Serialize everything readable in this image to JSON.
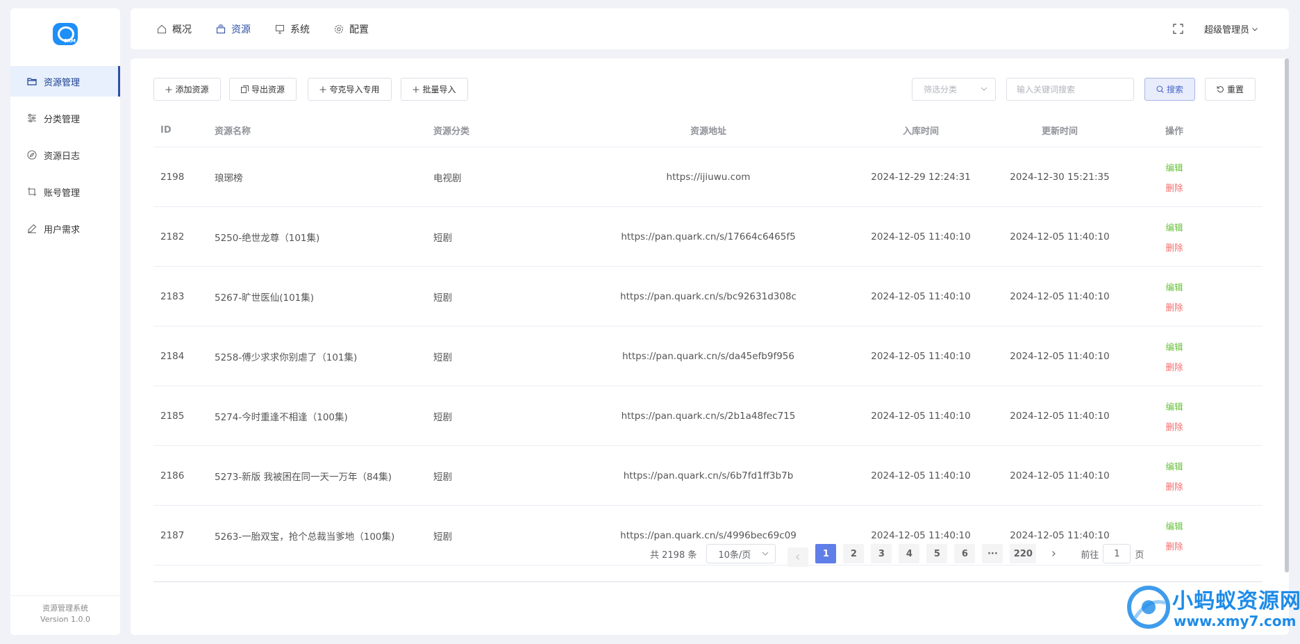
{
  "sidebar": {
    "logo_text": "CRM",
    "items": [
      {
        "label": "资源管理",
        "icon": "folder-icon",
        "active": true
      },
      {
        "label": "分类管理",
        "icon": "sliders-icon",
        "active": false
      },
      {
        "label": "资源日志",
        "icon": "compass-icon",
        "active": false
      },
      {
        "label": "账号管理",
        "icon": "crop-icon",
        "active": false
      },
      {
        "label": "用户需求",
        "icon": "pen-icon",
        "active": false
      }
    ],
    "footer_title": "资源管理系统",
    "footer_version": "Version 1.0.0"
  },
  "topbar": {
    "tabs": [
      {
        "label": "概况",
        "icon": "home-icon",
        "active": false
      },
      {
        "label": "资源",
        "icon": "stack-icon",
        "active": true
      },
      {
        "label": "系统",
        "icon": "monitor-icon",
        "active": false
      },
      {
        "label": "配置",
        "icon": "gear-icon",
        "active": false
      }
    ],
    "user_label": "超级管理员"
  },
  "toolbar": {
    "add_label": "添加资源",
    "export_label": "导出资源",
    "quark_import_label": "夸克导入专用",
    "batch_import_label": "批量导入",
    "category_placeholder": "筛选分类",
    "keyword_placeholder": "输入关键词搜索",
    "search_label": "搜索",
    "reset_label": "重置"
  },
  "table": {
    "headers": {
      "id": "ID",
      "name": "资源名称",
      "category": "资源分类",
      "url": "资源地址",
      "created": "入库时间",
      "updated": "更新时间",
      "actions": "操作"
    },
    "edit_label": "编辑",
    "delete_label": "删除",
    "rows": [
      {
        "id": "2198",
        "name": "琅琊榜",
        "category": "电视剧",
        "url": "https://ijiuwu.com",
        "created": "2024-12-29 12:24:31",
        "updated": "2024-12-30 15:21:35"
      },
      {
        "id": "2182",
        "name": "5250-绝世龙尊（101集)",
        "category": "短剧",
        "url": "https://pan.quark.cn/s/17664c6465f5",
        "created": "2024-12-05 11:40:10",
        "updated": "2024-12-05 11:40:10"
      },
      {
        "id": "2183",
        "name": "5267-旷世医仙(101集)",
        "category": "短剧",
        "url": "https://pan.quark.cn/s/bc92631d308c",
        "created": "2024-12-05 11:40:10",
        "updated": "2024-12-05 11:40:10"
      },
      {
        "id": "2184",
        "name": "5258-傅少求求你别虐了（101集)",
        "category": "短剧",
        "url": "https://pan.quark.cn/s/da45efb9f956",
        "created": "2024-12-05 11:40:10",
        "updated": "2024-12-05 11:40:10"
      },
      {
        "id": "2185",
        "name": "5274-今时重逢不相逢（100集)",
        "category": "短剧",
        "url": "https://pan.quark.cn/s/2b1a48fec715",
        "created": "2024-12-05 11:40:10",
        "updated": "2024-12-05 11:40:10"
      },
      {
        "id": "2186",
        "name": "5273-新版 我被困在同一天一万年（84集)",
        "category": "短剧",
        "url": "https://pan.quark.cn/s/6b7fd1ff3b7b",
        "created": "2024-12-05 11:40:10",
        "updated": "2024-12-05 11:40:10"
      },
      {
        "id": "2187",
        "name": "5263-一胎双宝，抢个总裁当爹地（100集)",
        "category": "短剧",
        "url": "https://pan.quark.cn/s/4996bec69c09",
        "created": "2024-12-05 11:40:10",
        "updated": "2024-12-05 11:40:10"
      }
    ]
  },
  "pagination": {
    "total_text": "共 2198 条",
    "page_size": "10条/页",
    "pages": [
      "1",
      "2",
      "3",
      "4",
      "5",
      "6"
    ],
    "ellipsis": "···",
    "last_page": "220",
    "current": "1",
    "goto_prefix": "前往",
    "goto_value": "1",
    "goto_suffix": "页"
  },
  "watermark": {
    "title": "小蚂蚁资源网",
    "url": "www.xmy7.com"
  },
  "colors": {
    "accent": "#2d4fa6",
    "page_active": "#5f7ee8",
    "edit": "#67c23a",
    "delete": "#f56c6c",
    "watermark": "#1d8be8"
  }
}
